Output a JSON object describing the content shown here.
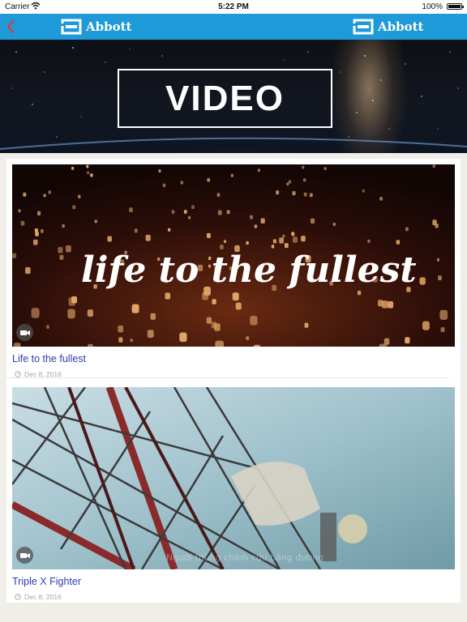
{
  "status_bar": {
    "carrier": "Carrier",
    "time": "5:22 PM",
    "battery": "100%"
  },
  "nav": {
    "brand_left": "Abbott",
    "brand_right": "Abbott"
  },
  "hero": {
    "title": "VIDEO"
  },
  "videos": [
    {
      "thumbnail_caption": "life to the fullest",
      "title": "Life to the fullest",
      "date": "Dec 8, 2016"
    },
    {
      "thumbnail_caption": "Người thùng chính cứu bằng đường",
      "title": "Triple X Fighter",
      "date": "Dec 8, 2016"
    }
  ],
  "colors": {
    "nav_bar": "#1e9ad8",
    "back_arrow": "#e23b30",
    "link": "#2c3dad",
    "page_bg": "#efeee8"
  },
  "icons": [
    "back-arrow-icon",
    "abbott-logo-icon",
    "wifi-icon",
    "battery-icon",
    "video-camera-icon",
    "clock-icon"
  ]
}
